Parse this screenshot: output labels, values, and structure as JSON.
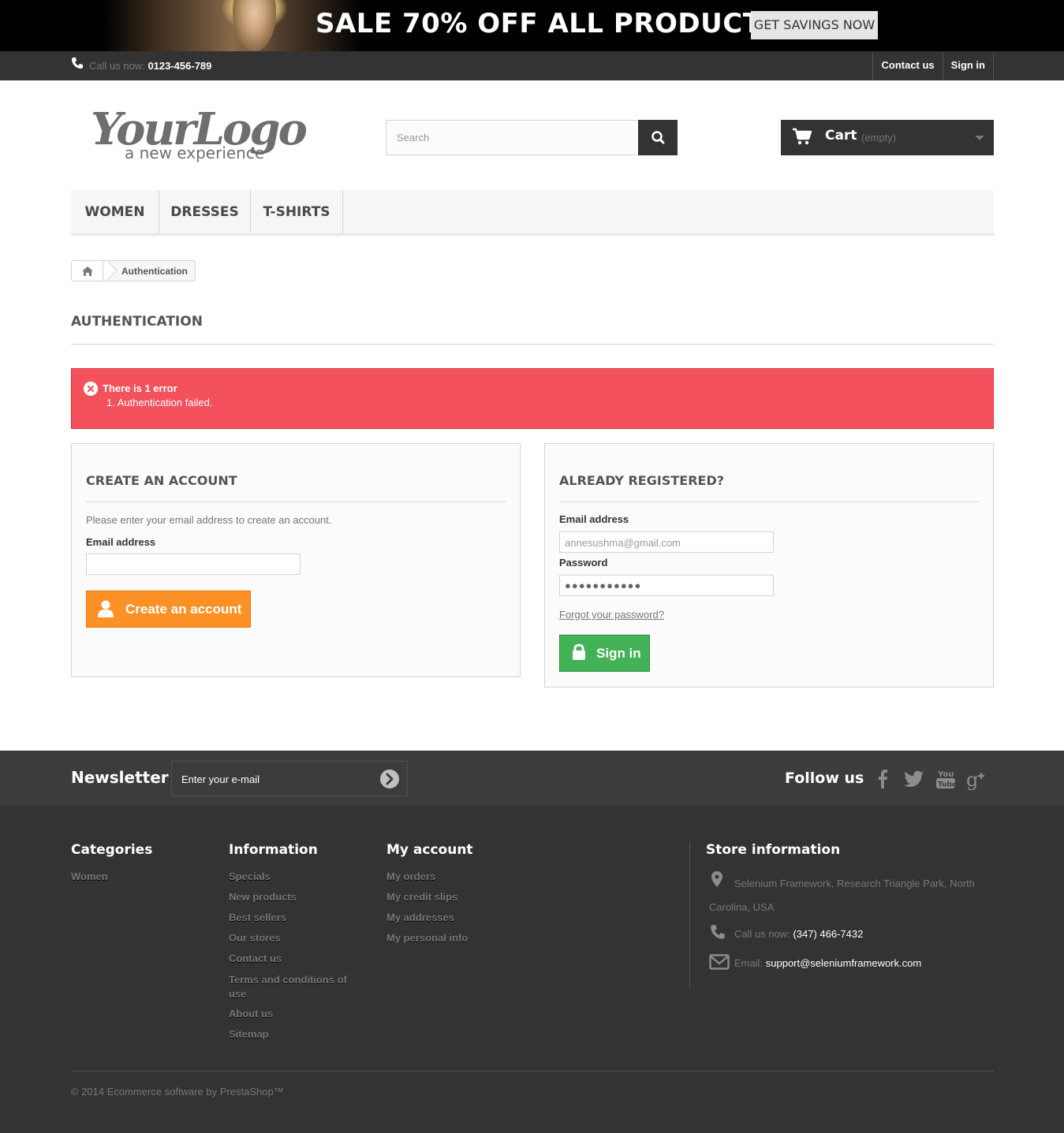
{
  "banner": {
    "headline": "SALE 70% OFF ALL PRODUCTS",
    "cta_label": "GET SAVINGS NOW"
  },
  "topnav": {
    "call_label": "Call us now:",
    "phone": "0123-456-789",
    "links": [
      "Contact us",
      "Sign in"
    ]
  },
  "header": {
    "logo_script": "YourLogo",
    "logo_tagline": "a new experience",
    "search_placeholder": "Search",
    "cart_label": "Cart",
    "cart_status": "(empty)"
  },
  "menu": {
    "items": [
      "WOMEN",
      "DRESSES",
      "T-SHIRTS"
    ]
  },
  "breadcrumb": {
    "current": "Authentication"
  },
  "page": {
    "heading": "AUTHENTICATION"
  },
  "alert": {
    "title": "There is 1 error",
    "items": [
      "1. Authentication failed."
    ]
  },
  "create_account": {
    "title": "CREATE AN ACCOUNT",
    "hint": "Please enter your email address to create an account.",
    "email_label": "Email address",
    "email_value": "",
    "button_label": "Create an account"
  },
  "login": {
    "title": "ALREADY REGISTERED?",
    "email_label": "Email address",
    "email_value": "annesushma@gmail.com",
    "password_label": "Password",
    "password_value": "●●●●●●●●●●●",
    "forgot_label": "Forgot your password?",
    "button_label": "Sign in"
  },
  "newsletter": {
    "title": "Newsletter",
    "placeholder": "Enter your e-mail",
    "follow_label": "Follow us",
    "social_icons": [
      "facebook-icon",
      "twitter-icon",
      "youtube-icon",
      "google-plus-icon"
    ]
  },
  "footer": {
    "categories": {
      "title": "Categories",
      "links": [
        "Women"
      ]
    },
    "information": {
      "title": "Information",
      "links": [
        "Specials",
        "New products",
        "Best sellers",
        "Our stores",
        "Contact us",
        "Terms and conditions of use",
        "About us",
        "Sitemap"
      ]
    },
    "my_account": {
      "title": "My account",
      "links": [
        "My orders",
        "My credit slips",
        "My addresses",
        "My personal info"
      ]
    },
    "store": {
      "title": "Store information",
      "address": "Selenium Framework, Research Triangle Park, North Carolina, USA",
      "call_label": "Call us now:",
      "phone": "(347) 466-7432",
      "email_label": "Email:",
      "email": "support@seleniumframework.com"
    },
    "copyright": "© 2014 Ecommerce software by PrestaShop™"
  },
  "colors": {
    "alert_red": "#f3515c",
    "create_orange": "#fe9126",
    "signin_green": "#43b155",
    "dark": "#333333"
  }
}
